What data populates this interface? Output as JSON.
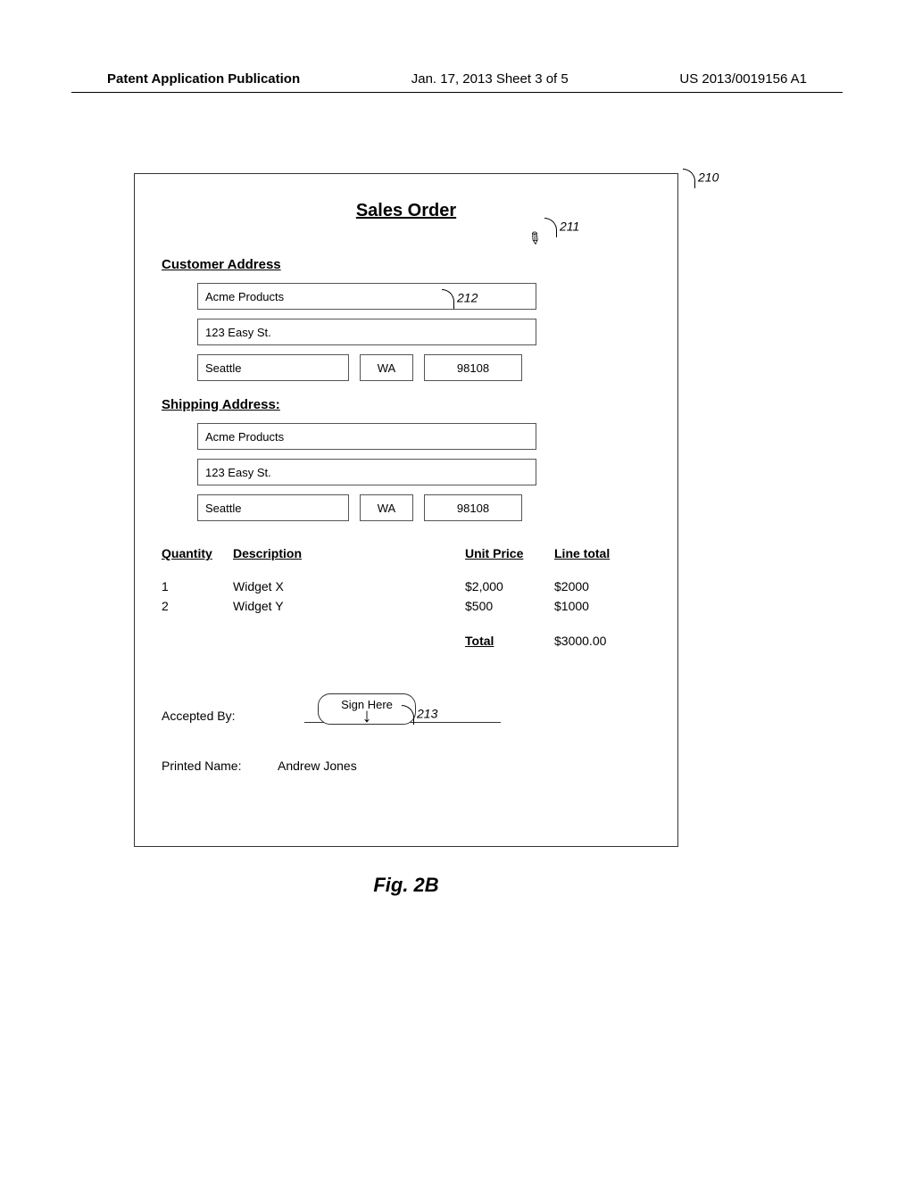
{
  "header": {
    "left": "Patent Application Publication",
    "center": "Jan. 17, 2013  Sheet 3 of 5",
    "right": "US 2013/0019156 A1"
  },
  "form": {
    "title": "Sales Order",
    "customer_label": "Customer Address",
    "shipping_label": "Shipping Address:",
    "customer": {
      "name": "Acme Products",
      "street": "123 Easy St.",
      "city": "Seattle",
      "state": "WA",
      "zip": "98108"
    },
    "shipping": {
      "name": "Acme Products",
      "street": "123 Easy St.",
      "city": "Seattle",
      "state": "WA",
      "zip": "98108"
    },
    "table": {
      "headers": {
        "qty": "Quantity",
        "desc": "Description",
        "unit": "Unit Price",
        "line": "Line total"
      },
      "rows": [
        {
          "qty": "1",
          "desc": "Widget X",
          "unit": "$2,000",
          "line": "$2000"
        },
        {
          "qty": "2",
          "desc": "Widget Y",
          "unit": "$500",
          "line": "$1000"
        }
      ],
      "total_label": "Total",
      "total_value": "$3000.00"
    },
    "signature": {
      "sign_here": "Sign Here",
      "accepted_label": "Accepted By:",
      "printed_label": "Printed Name:",
      "printed_value": "Andrew Jones"
    }
  },
  "callouts": {
    "c210": "210",
    "c211": "211",
    "c212": "212",
    "c213": "213"
  },
  "figure_caption": "Fig. 2B"
}
